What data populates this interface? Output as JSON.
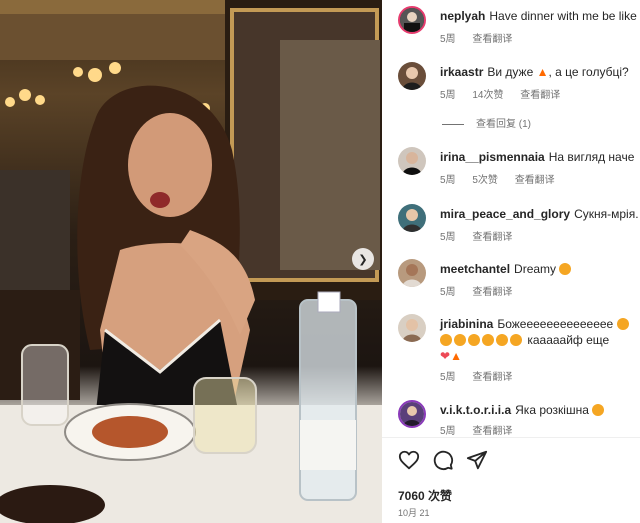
{
  "post": {
    "caption_user": "neplyah",
    "caption_text": "Have dinner with me be like",
    "caption_time": "5周",
    "caption_translate": "查看翻译"
  },
  "comments": [
    {
      "user": "irkaastr",
      "text": "Ви дуже",
      "text_after": ", а це голубці?",
      "time": "5周",
      "likes": "14次赞",
      "translate": "查看翻译"
    },
    {
      "user": "irina__pismennaia",
      "text": "На вигляд наче",
      "time": "5周",
      "likes": "5次赞",
      "translate": "查看翻译"
    },
    {
      "user": "mira_peace_and_glory",
      "text": "Сукня-мрія.",
      "time": "5周",
      "translate": "查看翻译"
    },
    {
      "user": "meetchantel",
      "text": "Dreamy",
      "time": "5周",
      "translate": "查看翻译"
    },
    {
      "user": "jriabinina",
      "text": "Божееееееееееееее",
      "text_line2": "кааааайф еще",
      "time": "5周",
      "translate": "查看翻译"
    },
    {
      "user": "v.i.k.t.o.r.i.i.a",
      "text": "Яка розкішна",
      "time": "5周",
      "translate": "查看翻译"
    }
  ],
  "replies_label": "查看回复 (1)",
  "likes_count": "7060 次赞",
  "date": "10月 21",
  "colors": {
    "accent_emoji": "#f5a623",
    "heart": "#ed4956",
    "fire": "#ff6a00",
    "meta": "#737373"
  },
  "icons": [
    "heart-icon",
    "comment-icon",
    "share-icon",
    "chevron-right-icon"
  ]
}
